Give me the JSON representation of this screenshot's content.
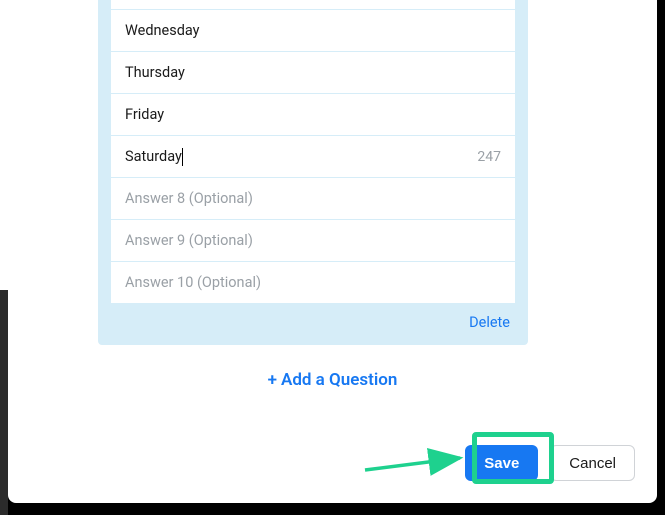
{
  "answers": {
    "filled": [
      {
        "label": "Wednesday"
      },
      {
        "label": "Thursday"
      },
      {
        "label": "Friday"
      },
      {
        "label": "Saturday",
        "charCount": "247",
        "active": true
      }
    ],
    "optional": [
      {
        "placeholder": "Answer 8 (Optional)"
      },
      {
        "placeholder": "Answer 9 (Optional)"
      },
      {
        "placeholder": "Answer 10 (Optional)"
      }
    ]
  },
  "deleteLabel": "Delete",
  "addQuestion": {
    "plus": "+",
    "label": "Add a Question"
  },
  "buttons": {
    "save": "Save",
    "cancel": "Cancel"
  },
  "highlightColor": "#1ed18e",
  "primaryColor": "#1778f2"
}
